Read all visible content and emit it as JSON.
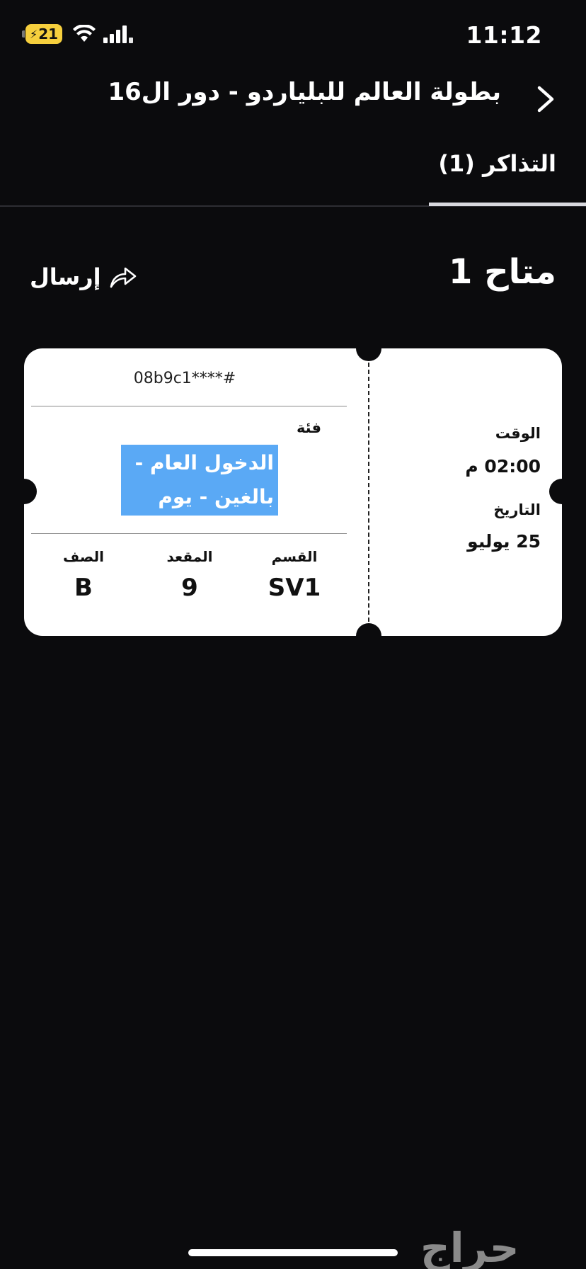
{
  "status_bar": {
    "time": "11:12",
    "battery": "21"
  },
  "header": {
    "title": "بطولة العالم للبلياردو - دور ال16",
    "back_icon": "chevron-right-icon"
  },
  "tabs": [
    {
      "label": "التذاكر (1)",
      "active": true
    }
  ],
  "gate": {
    "title": "متاح 1",
    "send_label": "إرسال",
    "send_icon": "share-arrow-icon"
  },
  "ticket": {
    "code": "08b9c1****#",
    "category_label": "فئة",
    "category_value_line1": "الدخول العام -",
    "category_value_line2": "بالغين - يوم كا...",
    "section_label": "القسم",
    "section_value": "SV1",
    "seat_label": "المقعد",
    "seat_value": "9",
    "row_label": "الصف",
    "row_value": "B",
    "time_label": "الوقت",
    "time_value": "02:00 م",
    "date_label": "التاريخ",
    "date_value": "25 يوليو"
  },
  "watermark": "حراج",
  "colors": {
    "background": "#0b0b0d",
    "ticket": "#ffffff",
    "highlight": "#5aa9f5",
    "battery": "#f6cf3d"
  }
}
